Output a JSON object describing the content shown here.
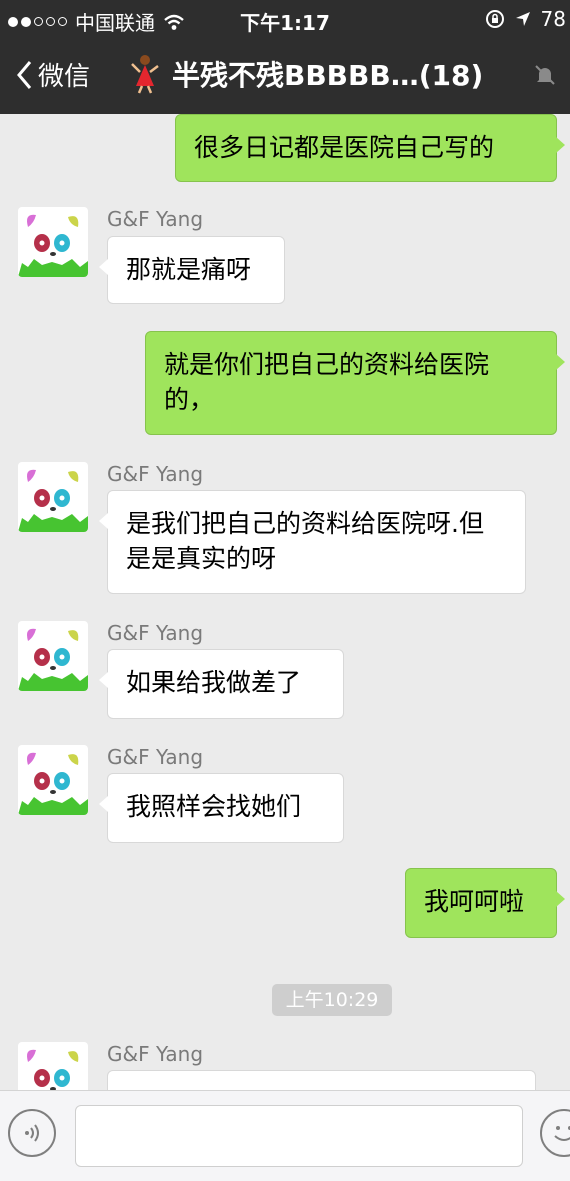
{
  "status_bar": {
    "carrier": "中国联通",
    "time": "下午1:17",
    "battery": "78"
  },
  "nav": {
    "back_label": "微信",
    "chat_title": "半残不残BBBBB…(18)"
  },
  "messages": [
    {
      "direction": "out",
      "text": "很多日记都是医院自己写的"
    },
    {
      "direction": "in",
      "sender": "G&F Yang",
      "text": "那就是痛呀"
    },
    {
      "direction": "out",
      "text": "就是你们把自己的资料给医院的，"
    },
    {
      "direction": "in",
      "sender": "G&F Yang",
      "text": "是我们把自己的资料给医院呀.但是是真实的呀"
    },
    {
      "direction": "in",
      "sender": "G&F Yang",
      "text": "如果给我做差了"
    },
    {
      "direction": "in",
      "sender": "G&F Yang",
      "text": "我照样会找她们"
    },
    {
      "direction": "out",
      "text": "我呵呵啦"
    },
    {
      "direction": "in",
      "sender": "G&F Yang",
      "text": ""
    }
  ],
  "timestamp": "上午10:29",
  "input": {
    "placeholder": ""
  },
  "icons": [
    "signal-icon",
    "wifi-icon",
    "orientation-lock-icon",
    "location-arrow-icon",
    "back-chevron-icon",
    "mute-bell-icon",
    "voice-icon",
    "emoji-icon"
  ],
  "colors": {
    "bar": "#2e2e2e",
    "outgoing_bubble": "#9fe45c",
    "incoming_bubble": "#ffffff",
    "background": "#ebebeb"
  }
}
